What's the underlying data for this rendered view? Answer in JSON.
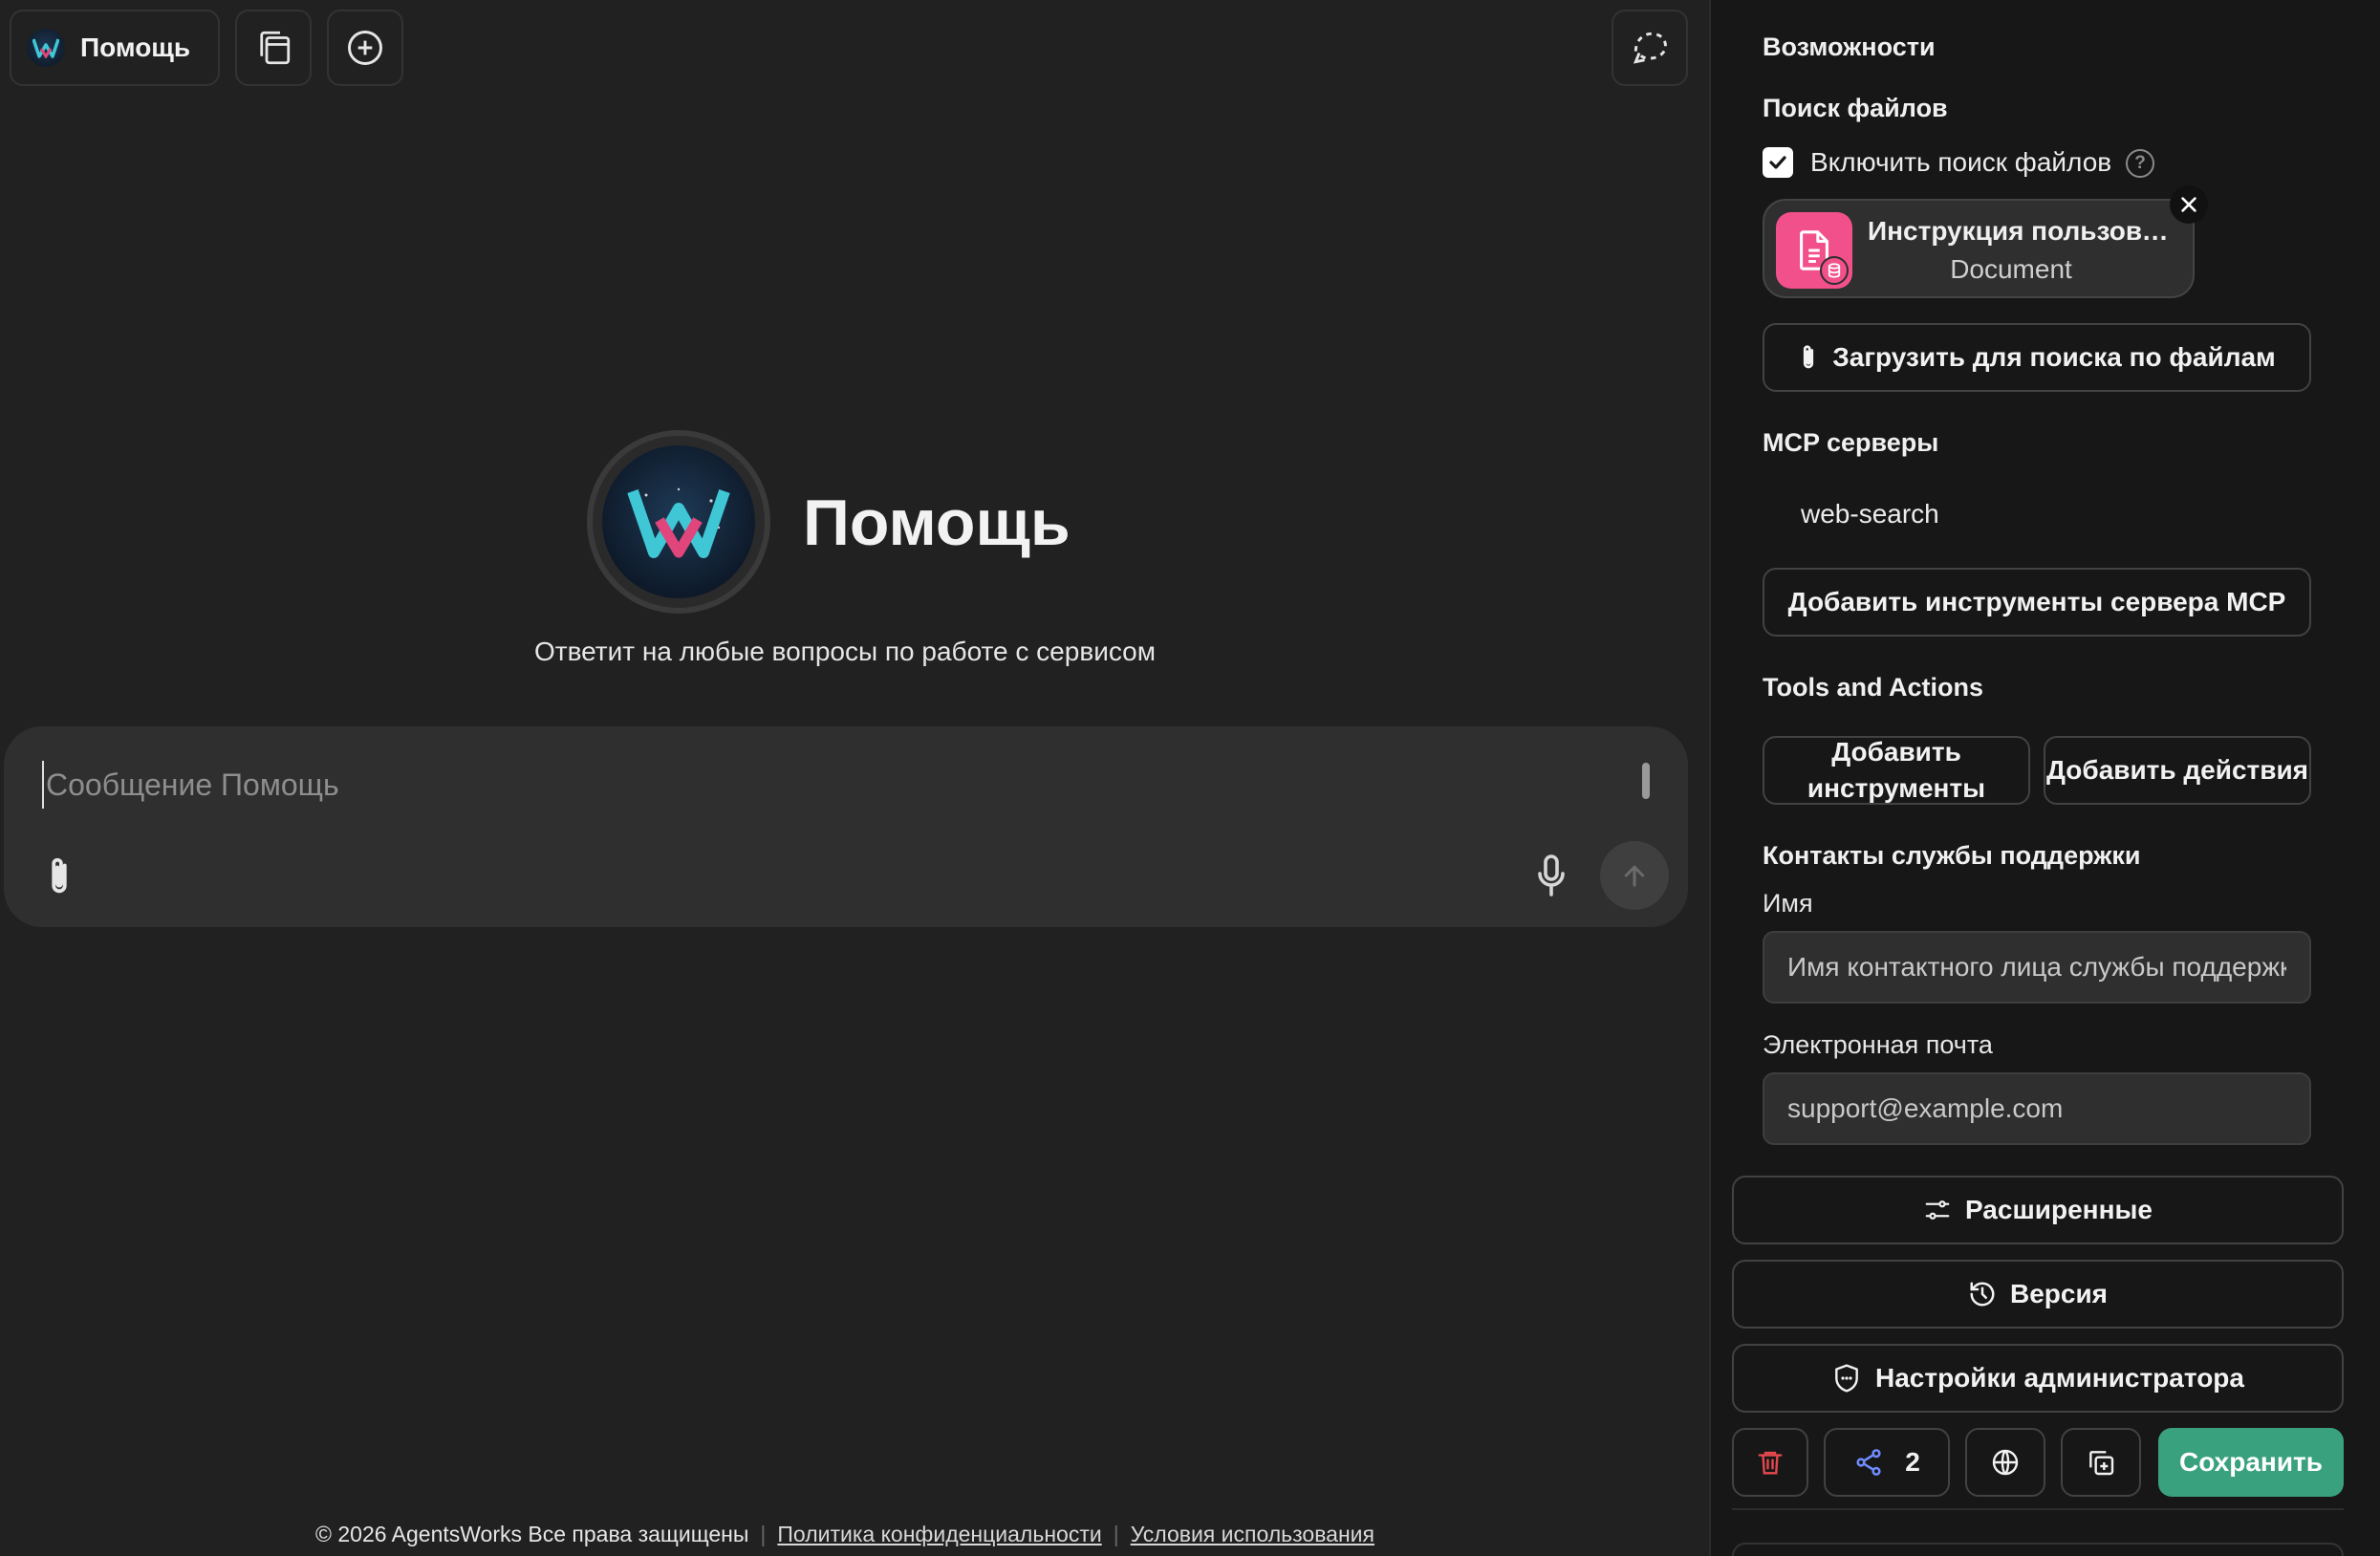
{
  "agent": {
    "name": "Помощь",
    "description": "Ответит на любые вопросы по работе с сервисом"
  },
  "composer": {
    "placeholder": "Сообщение Помощь"
  },
  "footer": {
    "copyright": "© 2026 AgentsWorks Все права защищены",
    "privacy": "Политика конфиденциальности",
    "terms": "Условия использования"
  },
  "panel": {
    "capabilities_title": "Возможности",
    "file_search": {
      "title": "Поиск файлов",
      "enable_label": "Включить поиск файлов",
      "enabled": true,
      "help_symbol": "?",
      "file": {
        "name": "Инструкция пользоват...",
        "type": "Document"
      },
      "upload_label": "Загрузить для поиска по файлам"
    },
    "mcp": {
      "title": "MCP серверы",
      "servers": [
        "web-search"
      ],
      "add_label": "Добавить инструменты сервера MCP"
    },
    "tools": {
      "title": "Tools and Actions",
      "add_tools_label": "Добавить инструменты",
      "add_actions_label": "Добавить действия"
    },
    "support": {
      "title": "Контакты службы поддержки",
      "name_label": "Имя",
      "name_placeholder": "Имя контактного лица службы поддержки",
      "email_label": "Электронная почта",
      "email_placeholder": "support@example.com"
    },
    "buttons": {
      "advanced": "Расширенные",
      "version": "Версия",
      "admin": "Настройки администратора",
      "share_count": "2",
      "save": "Сохранить"
    }
  },
  "colors": {
    "background": "#212121",
    "panel": "#171717",
    "accent_save": "#3aa17e",
    "file_icon": "#f2508a",
    "delete": "#e5484d"
  }
}
